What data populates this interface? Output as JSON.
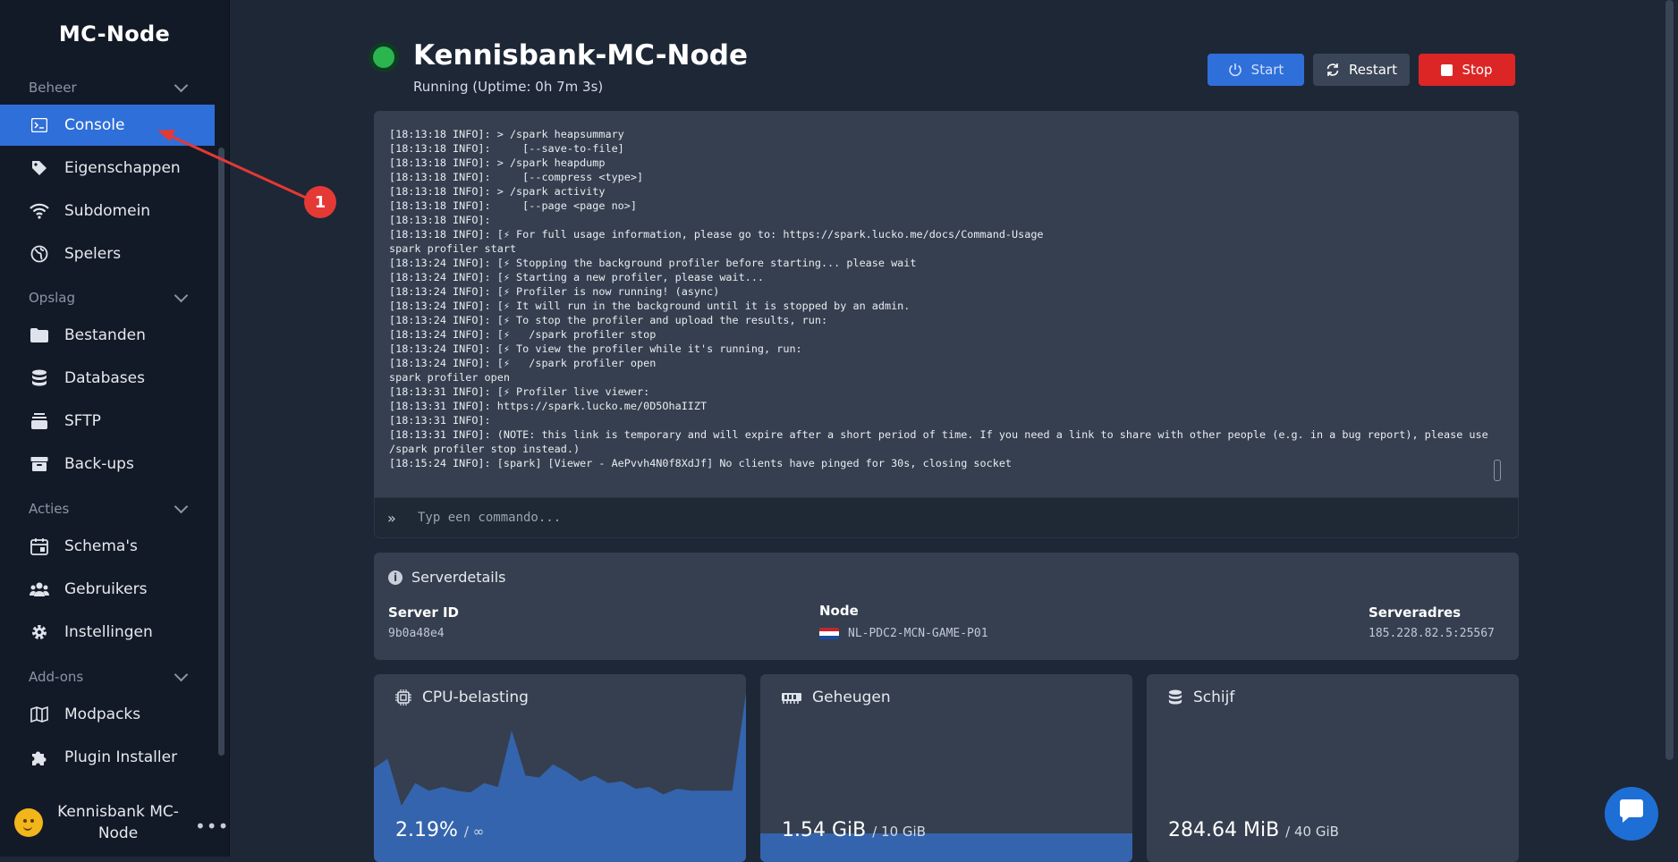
{
  "sidebar": {
    "brand": "MC-Node",
    "sections": [
      {
        "label": "Beheer"
      },
      {
        "label": "Opslag"
      },
      {
        "label": "Acties"
      },
      {
        "label": "Add-ons"
      }
    ],
    "items": [
      {
        "label": "Console",
        "icon": "terminal-icon",
        "active": true
      },
      {
        "label": "Eigenschappen",
        "icon": "tag-icon"
      },
      {
        "label": "Subdomein",
        "icon": "wifi-icon"
      },
      {
        "label": "Spelers",
        "icon": "globe-icon"
      },
      {
        "label": "Bestanden",
        "icon": "folder-icon"
      },
      {
        "label": "Databases",
        "icon": "database-icon"
      },
      {
        "label": "SFTP",
        "icon": "stack-icon"
      },
      {
        "label": "Back-ups",
        "icon": "archive-icon"
      },
      {
        "label": "Schema's",
        "icon": "calendar-icon"
      },
      {
        "label": "Gebruikers",
        "icon": "users-icon"
      },
      {
        "label": "Instellingen",
        "icon": "gear-icon"
      },
      {
        "label": "Modpacks",
        "icon": "map-icon"
      },
      {
        "label": "Plugin Installer",
        "icon": "puzzle-icon"
      }
    ],
    "user": {
      "name": "Kennisbank MC-Node",
      "more": "•••"
    }
  },
  "header": {
    "title": "Kennisbank-MC-Node",
    "status": "Running (Uptime: 0h 7m 3s)",
    "status_color": "#2bb54f",
    "buttons": {
      "start": "Start",
      "restart": "Restart",
      "stop": "Stop"
    }
  },
  "console": {
    "lines": [
      "[18:13:18 INFO]: > /spark heapsummary",
      "[18:13:18 INFO]:     [--save-to-file]",
      "[18:13:18 INFO]: > /spark heapdump",
      "[18:13:18 INFO]:     [--compress <type>]",
      "[18:13:18 INFO]: > /spark activity",
      "[18:13:18 INFO]:     [--page <page no>]",
      "[18:13:18 INFO]:",
      "[18:13:18 INFO]: [⚡ For full usage information, please go to: https://spark.lucko.me/docs/Command-Usage",
      "spark profiler start",
      "[18:13:24 INFO]: [⚡ Stopping the background profiler before starting... please wait",
      "[18:13:24 INFO]: [⚡ Starting a new profiler, please wait...",
      "[18:13:24 INFO]: [⚡ Profiler is now running! (async)",
      "[18:13:24 INFO]: [⚡ It will run in the background until it is stopped by an admin.",
      "[18:13:24 INFO]: [⚡ To stop the profiler and upload the results, run:",
      "[18:13:24 INFO]: [⚡   /spark profiler stop",
      "[18:13:24 INFO]: [⚡ To view the profiler while it's running, run:",
      "[18:13:24 INFO]: [⚡   /spark profiler open",
      "spark profiler open",
      "[18:13:31 INFO]: [⚡ Profiler live viewer:",
      "[18:13:31 INFO]: https://spark.lucko.me/0D5OhaIIZT",
      "[18:13:31 INFO]:",
      "[18:13:31 INFO]: (NOTE: this link is temporary and will expire after a short period of time. If you need a link to share with other people (e.g. in a bug report), please use /spark profiler stop instead.)",
      "[18:15:24 INFO]: [spark] [Viewer - AePvvh4N0f8XdJf] No clients have pinged for 30s, closing socket"
    ],
    "placeholder": "Typ een commando..."
  },
  "details": {
    "title": "Serverdetails",
    "server_id_label": "Server ID",
    "server_id": "9b0a48e4",
    "node_label": "Node",
    "node": "NL-PDC2-MCN-GAME-P01",
    "address_label": "Serveradres",
    "address": "185.228.82.5:25567"
  },
  "stats": {
    "cpu": {
      "label": "CPU-belasting",
      "value": "2.19%",
      "limit": "/ ∞",
      "history": [
        50,
        55,
        30,
        42,
        38,
        40,
        38,
        37,
        42,
        40,
        70,
        46,
        45,
        52,
        48,
        43,
        46,
        42,
        43,
        39,
        40,
        36,
        39,
        38,
        38,
        38,
        38,
        90
      ]
    },
    "memory": {
      "label": "Geheugen",
      "value": "1.54 GiB",
      "limit": "/ 10 GiB",
      "fraction": 0.154
    },
    "disk": {
      "label": "Schijf",
      "value": "284.64 MiB",
      "limit": "/ 40 GiB"
    }
  },
  "annotation": {
    "badge": "1"
  },
  "colors": {
    "accent": "#2f6fd9",
    "stop": "#dc2626",
    "panel": "#353f4f",
    "sidebar": "#131a27"
  }
}
